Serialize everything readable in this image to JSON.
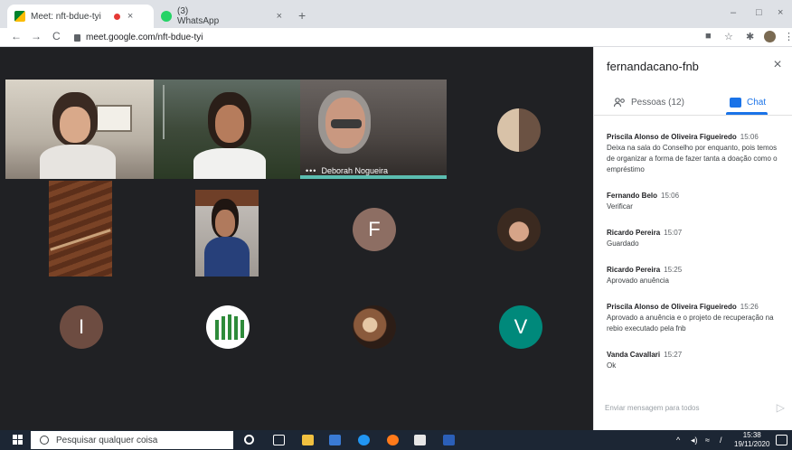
{
  "browser": {
    "tabs": [
      {
        "title": "Meet: nft-bdue-tyi",
        "close": "×"
      },
      {
        "title": "(3) WhatsApp",
        "close": "×"
      }
    ],
    "new_tab": "+",
    "window_controls": [
      "–",
      "□",
      "×"
    ],
    "nav": [
      "←",
      "→",
      "C"
    ],
    "url": "meet.google.com/nft-bdue-tyi",
    "toolbar_icons": [
      "camera-icon",
      "star-icon",
      "puzzle-icon",
      "profile-avatar",
      "menu-icon"
    ]
  },
  "meeting": {
    "participants": [
      {
        "letter": "F",
        "color": "#8d6e63"
      },
      {
        "letter": "I",
        "color": "#6d4c41"
      },
      {
        "letter": "V",
        "color": "#00897b"
      }
    ],
    "speaker_name": "Deborah Nogueira"
  },
  "panel": {
    "title": "fernandacano-fnb",
    "close": "×",
    "people_tab": "Pessoas (12)",
    "chat_tab": "Chat",
    "messages": [
      {
        "sender": "Priscila Alonso de Oliveira Figueiredo",
        "time": "15:06",
        "text": "Deixa na sala do Conselho por enquanto, pois temos de organizar a forma de fazer tanta a doação como o empréstimo"
      },
      {
        "sender": "Fernando Belo",
        "time": "15:06",
        "text": "Verificar"
      },
      {
        "sender": "Ricardo Pereira",
        "time": "15:07",
        "text": "Guardado"
      },
      {
        "sender": "Ricardo Pereira",
        "time": "15:25",
        "text": "Aprovado anuência"
      },
      {
        "sender": "Priscila Alonso de Oliveira Figueiredo",
        "time": "15:26",
        "text": "Aprovado a anuência e o projeto de recuperação na rebio executado pela fnb"
      },
      {
        "sender": "Vanda Cavallari",
        "time": "15:27",
        "text": "Ok"
      }
    ],
    "compose_placeholder": "Enviar mensagem para todos",
    "accent": "#1a73e8"
  },
  "taskbar": {
    "search_placeholder": "Pesquisar qualquer coisa",
    "time": "15:38",
    "date": "19/11/2020"
  }
}
